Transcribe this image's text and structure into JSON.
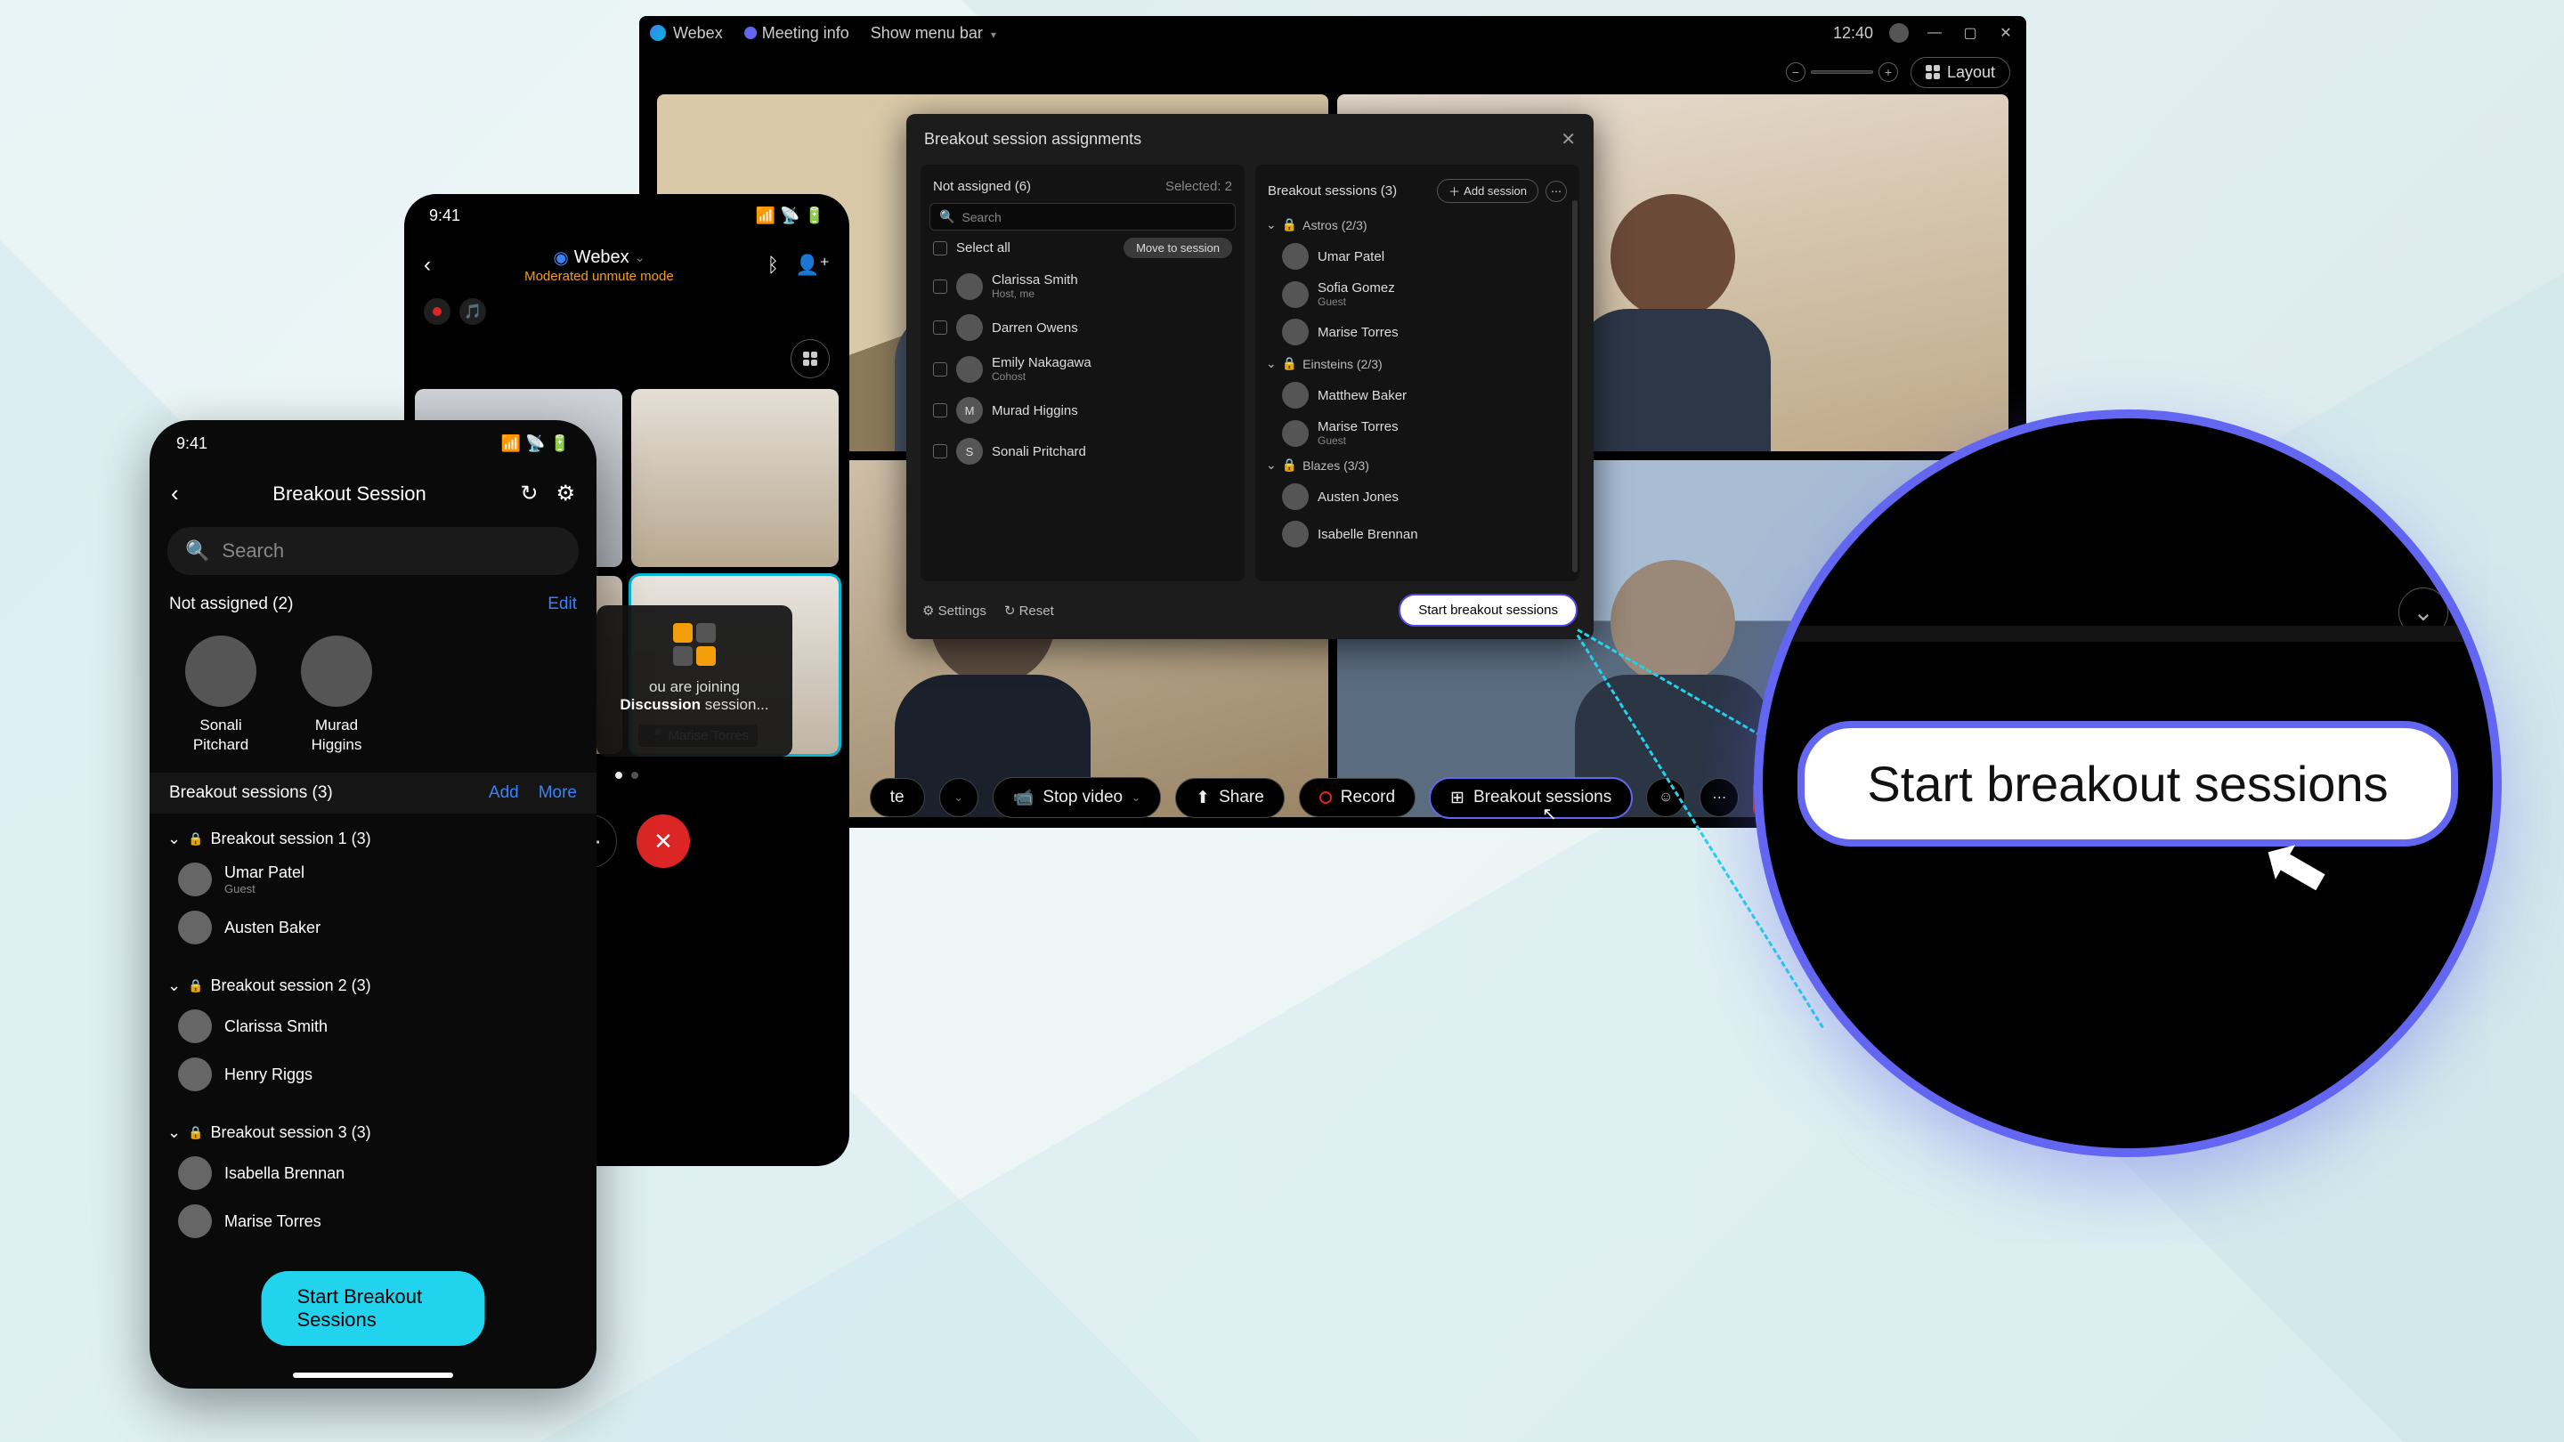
{
  "desktop": {
    "titlebar": {
      "appName": "Webex",
      "meetingInfo": "Meeting info",
      "menuBar": "Show menu bar",
      "clock": "12:40"
    },
    "layoutButton": "Layout",
    "controls": {
      "mute": "te",
      "stopVideo": "Stop video",
      "share": "Share",
      "record": "Record",
      "breakout": "Breakout sessions"
    }
  },
  "modal": {
    "title": "Breakout session assignments",
    "leftHeader": "Not assigned (6)",
    "selected": "Selected: 2",
    "searchPlaceholder": "Search",
    "selectAll": "Select all",
    "moveBtn": "Move to session",
    "unassigned": [
      {
        "name": "Clarissa Smith",
        "sub": "Host, me",
        "initial": ""
      },
      {
        "name": "Darren Owens",
        "sub": "",
        "initial": ""
      },
      {
        "name": "Emily Nakagawa",
        "sub": "Cohost",
        "initial": ""
      },
      {
        "name": "Murad Higgins",
        "sub": "",
        "initial": "M"
      },
      {
        "name": "Sonali Pritchard",
        "sub": "",
        "initial": "S"
      }
    ],
    "rightHeader": "Breakout sessions (3)",
    "addSession": "Add session",
    "groups": [
      {
        "name": "Astros (2/3)",
        "members": [
          {
            "name": "Umar Patel",
            "sub": ""
          },
          {
            "name": "Sofia Gomez",
            "sub": "Guest"
          },
          {
            "name": "Marise Torres",
            "sub": ""
          }
        ]
      },
      {
        "name": "Einsteins (2/3)",
        "members": [
          {
            "name": "Matthew Baker",
            "sub": ""
          },
          {
            "name": "Marise Torres",
            "sub": "Guest"
          }
        ]
      },
      {
        "name": "Blazes (3/3)",
        "members": [
          {
            "name": "Austen Jones",
            "sub": ""
          },
          {
            "name": "Isabelle Brennan",
            "sub": ""
          }
        ]
      }
    ],
    "settings": "Settings",
    "reset": "Reset",
    "start": "Start breakout sessions"
  },
  "tablet": {
    "time": "9:41",
    "title": "Webex",
    "subtitle": "Moderated unmute mode",
    "activeTile": "Marise Torres",
    "joining1": "ou are joining",
    "joining2a": "Discussion",
    "joining2b": " session..."
  },
  "phone": {
    "time": "9:41",
    "title": "Breakout Session",
    "searchPlaceholder": "Search",
    "notAssigned": "Not assigned (2)",
    "edit": "Edit",
    "people": [
      {
        "name": "Sonali Pitchard"
      },
      {
        "name": "Murad Higgins"
      }
    ],
    "bsHeader": "Breakout sessions (3)",
    "add": "Add",
    "more": "More",
    "groups": [
      {
        "name": "Breakout session 1 (3)",
        "locked": true,
        "members": [
          {
            "name": "Umar Patel",
            "sub": "Guest"
          },
          {
            "name": "Austen Baker",
            "sub": ""
          }
        ]
      },
      {
        "name": "Breakout session 2 (3)",
        "locked": true,
        "members": [
          {
            "name": "Clarissa Smith",
            "sub": ""
          },
          {
            "name": "Henry Riggs",
            "sub": ""
          }
        ]
      },
      {
        "name": "Breakout session 3 (3)",
        "locked": true,
        "members": [
          {
            "name": "Isabella Brennan",
            "sub": ""
          },
          {
            "name": "Marise Torres",
            "sub": ""
          }
        ]
      }
    ],
    "start": "Start Breakout Sessions"
  },
  "magnifier": {
    "button": "Start breakout sessions"
  }
}
